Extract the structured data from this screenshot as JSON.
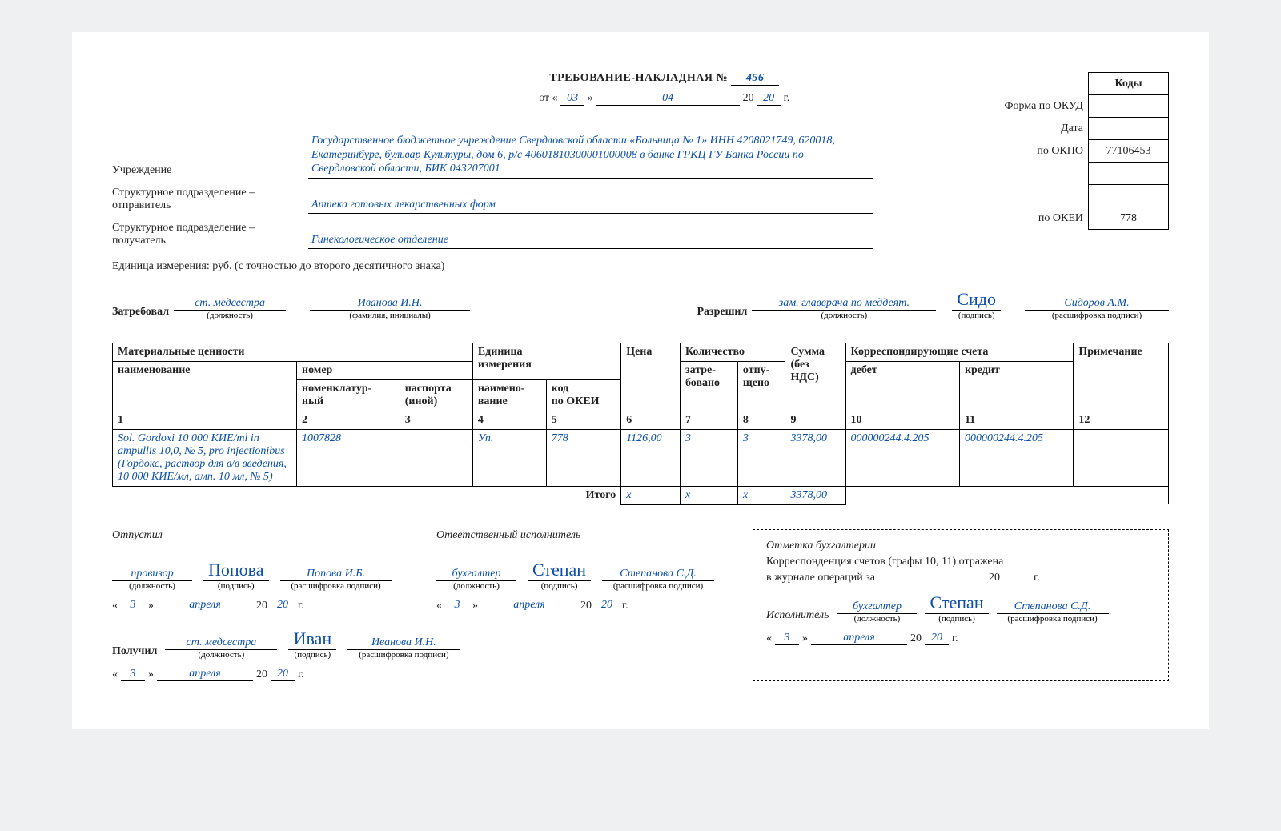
{
  "title": "ТРЕБОВАНИЕ-НАКЛАДНАЯ №",
  "doc_number": "456",
  "date": {
    "day": "03",
    "month": "04",
    "year": "20",
    "from_label": "от «",
    "close_q": "»",
    "year_prefix": "20",
    "year_suffix": "г."
  },
  "codes": {
    "header": "Коды",
    "rows": {
      "okud_label": "Форма по ОКУД",
      "okud": "",
      "date_label": "Дата",
      "date": "",
      "okpo_label": "по ОКПО",
      "okpo": "77106453",
      "blank": "",
      "okei_label": "по ОКЕИ",
      "okei": "778"
    }
  },
  "org": {
    "label": "Учреждение",
    "value": "Государственное бюджетное учреждение Свердловской области «Больница № 1» ИНН 4208021749, 620018, Екатеринбург, бульвар Культуры, дом 6, р/с 40601810300001000008 в банке ГРКЦ ГУ Банка России по Свердловской области, БИК 043207001"
  },
  "sender": {
    "label": "Структурное подразделение –\nотправитель",
    "value": "Аптека готовых лекарственных форм"
  },
  "receiver": {
    "label": "Структурное подразделение –\nполучатель",
    "value": "Гинекологическое отделение"
  },
  "unit_note": "Единица измерения: руб. (с точностью до второго десятичного знака)",
  "requested": {
    "label": "Затребовал",
    "position": "ст. медсестра",
    "position_sub": "(должность)",
    "name": "Иванова И.Н.",
    "name_sub": "(фамилия, инициалы)"
  },
  "approved": {
    "label": "Разрешил",
    "position": "зам. главврача по меддеят.",
    "position_sub": "(должность)",
    "sign": "Сидо",
    "sign_sub": "(подпись)",
    "name": "Сидоров А.М.",
    "name_sub": "(расшифровка подписи)"
  },
  "table": {
    "headers": {
      "h1": "Материальные ценности",
      "h1a": "наименование",
      "h1b": "номер",
      "h1b1": "номенклатур-\nный",
      "h1b2": "паспорта\n(иной)",
      "h2": "Единица\nизмерения",
      "h2a": "наимено-\nвание",
      "h2b": "код\nпо ОКЕИ",
      "h3": "Цена",
      "h4": "Количество",
      "h4a": "затре-\nбовано",
      "h4b": "отпу-\nщено",
      "h5": "Сумма\n(без\nНДС)",
      "h6": "Корреспондирующие счета",
      "h6a": "дебет",
      "h6b": "кредит",
      "h7": "Примечание"
    },
    "cols": [
      "1",
      "2",
      "3",
      "4",
      "5",
      "6",
      "7",
      "8",
      "9",
      "10",
      "11",
      "12"
    ],
    "row": {
      "c1": "Sol. Gordoxi  10 000 КИЕ/ml in ampullis 10,0, № 5, pro injectionibus (Гордокс, раствор для в/в введения, 10 000 КИЕ/мл, амп. 10 мл, № 5)",
      "c2": "1007828",
      "c3": "",
      "c4": "Уп.",
      "c5": "778",
      "c6": "1126,00",
      "c7": "3",
      "c8": "3",
      "c9": "3378,00",
      "c10": "000000244.4.205",
      "c11": "000000244.4.205",
      "c12": ""
    },
    "total": {
      "label": "Итого",
      "c6": "x",
      "c7": "x",
      "c8": "x",
      "c9": "3378,00"
    }
  },
  "released": {
    "label": "Отпустил",
    "position": "провизор",
    "position_sub": "(должность)",
    "sign": "Попова",
    "sign_sub": "(подпись)",
    "name": "Попова И.Б.",
    "name_sub": "(расшифровка подписи)",
    "day": "3",
    "month": "апреля",
    "year": "20"
  },
  "responsible": {
    "label": "Ответственный исполнитель",
    "position": "бухгалтер",
    "position_sub": "(должность)",
    "sign": "Степан",
    "sign_sub": "(подпись)",
    "name": "Степанова С.Д.",
    "name_sub": "(расшифровка подписи)",
    "day": "3",
    "month": "апреля",
    "year": "20"
  },
  "received": {
    "label": "Получил",
    "position": "ст. медсестра",
    "position_sub": "(должность)",
    "sign": "Иван",
    "sign_sub": "(подпись)",
    "name": "Иванова И.Н.",
    "name_sub": "(расшифровка подписи)",
    "day": "3",
    "month": "апреля",
    "year": "20"
  },
  "accounting": {
    "title": "Отметка бухгалтерии",
    "line1": "Корреспонденция счетов (графы 10, 11) отражена",
    "line2_a": "в журнале операций за",
    "year_prefix": "20",
    "year_suffix": "г.",
    "exec_label": "Исполнитель",
    "position": "бухгалтер",
    "position_sub": "(должность)",
    "sign": "Степан",
    "sign_sub": "(подпись)",
    "name": "Степанова С.Д.",
    "name_sub": "(расшифровка подписи)",
    "day": "3",
    "month": "апреля",
    "year": "20"
  }
}
